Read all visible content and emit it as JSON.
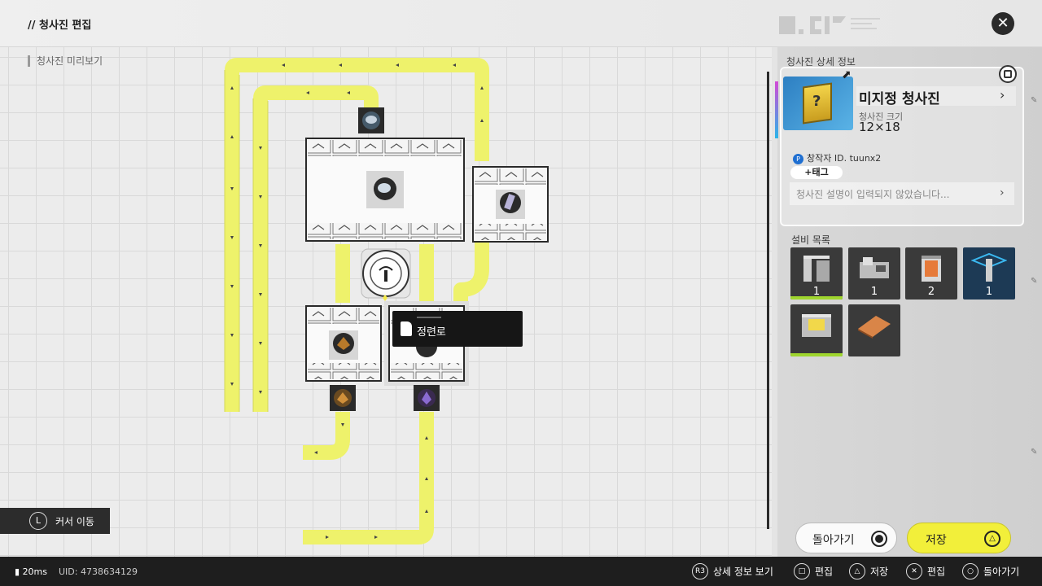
{
  "header": {
    "title": "// 청사진 편집",
    "close_symbol": "✕"
  },
  "preview": {
    "label": "청사진 미리보기"
  },
  "detail": {
    "section_label": "청사진 상세 정보",
    "name": "미지정 청사진",
    "size_label": "청사진 크기",
    "size_value": "12×18",
    "creator": "창작자 ID. tuunx2",
    "tag_button": "+태그",
    "description_placeholder": "청사진 설명이 입력되지 않았습니다..."
  },
  "equipment": {
    "label": "설비 목록",
    "items": [
      {
        "icon": "pillar-machine-icon",
        "count": "1",
        "color": "#9fd62e"
      },
      {
        "icon": "workbench-machine-icon",
        "count": "1",
        "color": "#3a3a3a"
      },
      {
        "icon": "furnace-machine-icon",
        "count": "2",
        "color": "#3a3a3a"
      },
      {
        "icon": "blue-tower-icon",
        "count": "1",
        "color": "#3a3a3a"
      },
      {
        "icon": "storage-box-icon",
        "count": "",
        "color": "#9fd62e"
      },
      {
        "icon": "orange-floor-icon",
        "count": "",
        "color": "#3a3a3a"
      }
    ]
  },
  "tooltip": {
    "name": "정련로"
  },
  "buttons": {
    "back": "돌아가기",
    "save": "저장"
  },
  "cursor_hint": {
    "key": "L",
    "label": "커서 이동"
  },
  "status": {
    "ping": "20ms",
    "uid": "UID: 4738634129"
  },
  "controls": [
    {
      "key": "R3",
      "label": "상세 정보 보기"
    },
    {
      "key": "□",
      "label": "편집"
    },
    {
      "key": "△",
      "label": "저장"
    },
    {
      "key": "✕",
      "label": "편집"
    },
    {
      "key": "○",
      "label": "돌아가기"
    }
  ],
  "colors": {
    "conveyor": "#eef26b",
    "accent_yellow": "#f2ef3a",
    "machine_frame": "#2a2a2a"
  }
}
